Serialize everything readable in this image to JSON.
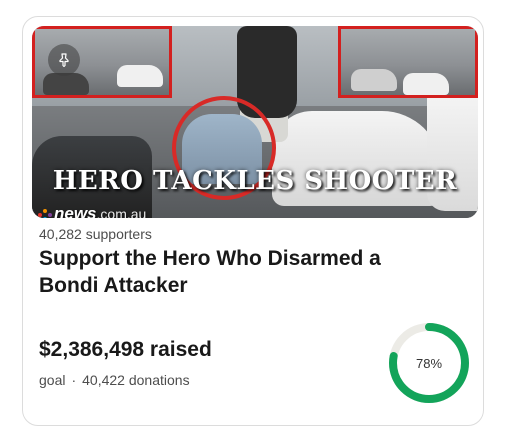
{
  "image": {
    "headline": "HERO TACKLES SHOOTER",
    "brand": "news",
    "brand_suffix": ".com.au",
    "pin_icon": "pin-icon"
  },
  "campaign": {
    "supporters": "40,282 supporters",
    "title": "Support the Hero Who Disarmed a Bondi Attacker",
    "raised": "$2,386,498 raised",
    "goal_label": "goal",
    "separator": "·",
    "donations": "40,422 donations",
    "progress_percent": 78,
    "progress_label": "78%"
  },
  "colors": {
    "progress": "#13a45a",
    "progress_track": "#ecebe6",
    "highlight_red": "#d3201f"
  }
}
